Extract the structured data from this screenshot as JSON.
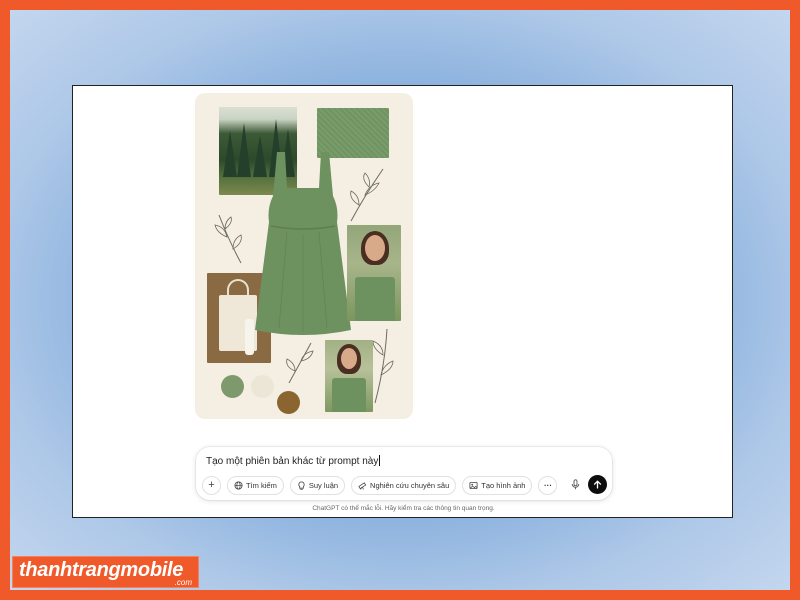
{
  "composer": {
    "prompt_text": "Tạo một phiên bản khác từ prompt này",
    "tools": {
      "add_label": "+",
      "search_label": "Tìm kiếm",
      "reason_label": "Suy luận",
      "deep_research_label": "Nghiên cứu chuyên sâu",
      "create_image_label": "Tạo hình ảnh",
      "more_label": "···"
    },
    "icons": [
      "globe-icon",
      "lightbulb-icon",
      "telescope-icon",
      "image-icon",
      "mic-icon",
      "arrow-up-icon"
    ]
  },
  "disclaimer": "ChatGPT có thể mắc lỗi. Hãy kiểm tra các thông tin quan trọng.",
  "brand": {
    "name": "thanhtrangmobile",
    "domain": ".com"
  },
  "colors": {
    "frame_orange": "#f0592a",
    "dress_green": "#6e9160",
    "send_black": "#0d0d0d"
  }
}
